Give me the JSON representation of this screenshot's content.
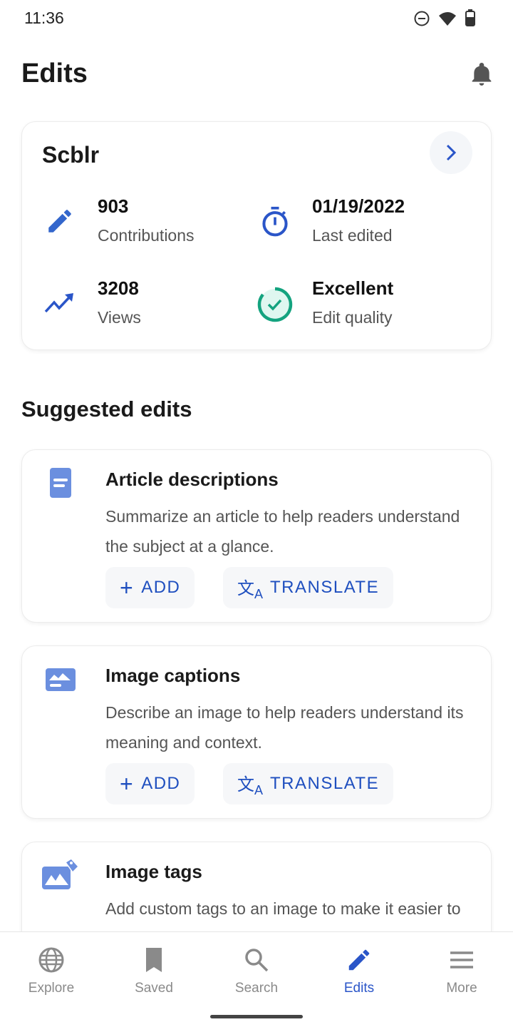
{
  "status_bar": {
    "time": "11:36",
    "icons": [
      "do-not-disturb-icon",
      "wifi-icon",
      "battery-icon"
    ]
  },
  "header": {
    "title": "Edits",
    "icon": "bell-icon"
  },
  "profile_card": {
    "username": "Scblr",
    "stats": [
      {
        "value": "903",
        "label": "Contributions",
        "icon": "pencil-icon"
      },
      {
        "value": "01/19/2022",
        "label": "Last edited",
        "icon": "stopwatch-icon"
      },
      {
        "value": "3208",
        "label": "Views",
        "icon": "trending-up-icon"
      },
      {
        "value": "Excellent",
        "label": "Edit quality",
        "icon": "check-circle-icon"
      }
    ]
  },
  "suggested": {
    "title": "Suggested edits",
    "cards": [
      {
        "title": "Article descriptions",
        "description": "Summarize an article to help readers understand the subject at a glance.",
        "add": "ADD",
        "translate": "TRANSLATE"
      },
      {
        "title": "Image captions",
        "description": "Describe an image to help readers understand its meaning and context.",
        "add": "ADD",
        "translate": "TRANSLATE"
      },
      {
        "title": "Image tags",
        "description": "Add custom tags to an image to make it easier to find."
      }
    ]
  },
  "nav": [
    {
      "label": "Explore"
    },
    {
      "label": "Saved"
    },
    {
      "label": "Search"
    },
    {
      "label": "Edits",
      "active": true
    },
    {
      "label": "More"
    }
  ],
  "colors": {
    "accent": "#3366cc",
    "button_text": "#1f4fbf",
    "quality": "#14a37f"
  }
}
